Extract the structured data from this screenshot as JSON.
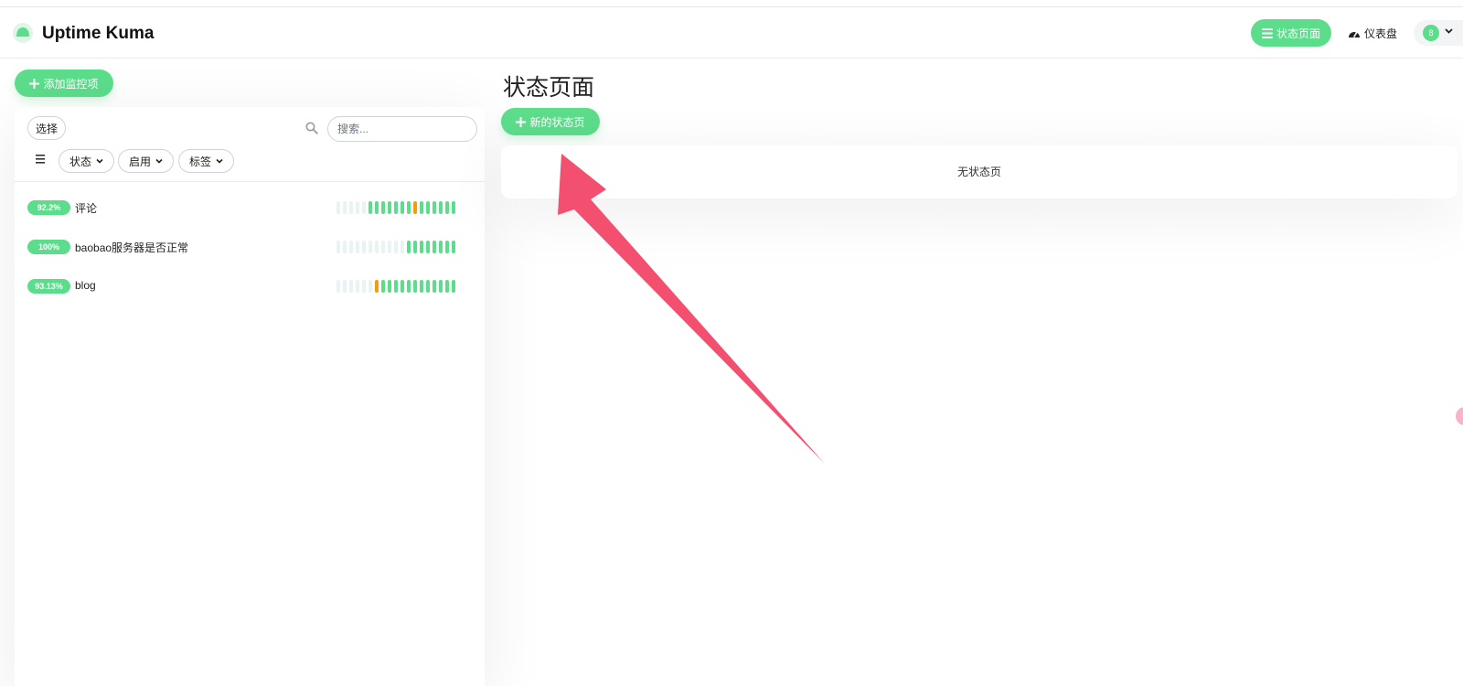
{
  "header": {
    "app_title": "Uptime Kuma",
    "nav_status_label": "状态页面",
    "nav_dashboard_label": "仪表盘",
    "avatar_text": "8"
  },
  "sidebar": {
    "add_monitor_label": "添加监控项",
    "select_label": "选择",
    "search_placeholder": "搜索...",
    "filters": [
      {
        "label": "状态"
      },
      {
        "label": "启用"
      },
      {
        "label": "标签"
      }
    ],
    "monitors": [
      {
        "uptime": "92.2%",
        "name": "评论",
        "beats": [
          "empty",
          "empty",
          "empty",
          "empty",
          "empty",
          "up",
          "up",
          "up",
          "up",
          "up",
          "up",
          "up",
          "down",
          "up",
          "up",
          "up",
          "up",
          "up",
          "up"
        ]
      },
      {
        "uptime": "100%",
        "name": "baobao服务器是否正常",
        "beats": [
          "empty",
          "empty",
          "empty",
          "empty",
          "empty",
          "empty",
          "empty",
          "empty",
          "empty",
          "empty",
          "empty",
          "up",
          "up",
          "up",
          "up",
          "up",
          "up",
          "up",
          "up"
        ]
      },
      {
        "uptime": "93.13%",
        "name": "blog",
        "beats": [
          "empty",
          "empty",
          "empty",
          "empty",
          "empty",
          "empty",
          "down",
          "up",
          "up",
          "up",
          "up",
          "up",
          "up",
          "up",
          "up",
          "up",
          "up",
          "up",
          "up"
        ]
      }
    ]
  },
  "main": {
    "title": "状态页面",
    "new_status_label": "新的状态页",
    "empty_text": "无状态页"
  },
  "colors": {
    "accent": "#5cdd8b",
    "warning": "#f29d0a",
    "empty_beat": "#e8f3f3",
    "annotation_arrow": "#f2506e"
  }
}
